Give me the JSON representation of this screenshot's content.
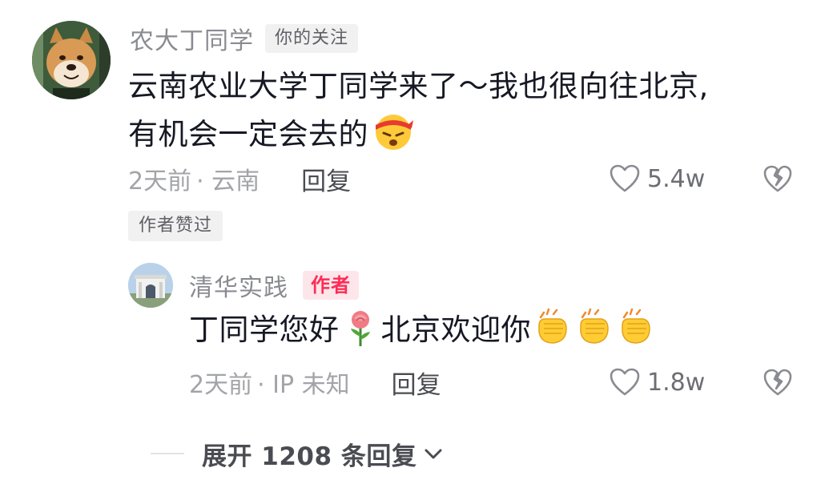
{
  "comment": {
    "username": "农大丁同学",
    "relation_tag": "你的关注",
    "text_line1": "云南农业大学丁同学来了～我也很向往北京,",
    "text_line2": "有机会一定会去的",
    "emoji": "angry-headband-emoji",
    "time": "2天前",
    "location": "· 云南",
    "reply_label": "回复",
    "likes": "5.4w",
    "author_liked": "作者赞过"
  },
  "reply": {
    "username": "清华实践",
    "author_tag": "作者",
    "text_before_emoji": "丁同学您好",
    "emoji_rose": "rose-emoji",
    "text_after_emoji": "北京欢迎你",
    "emoji_clap": "clapping-hands-emoji",
    "time": "2天前",
    "location": "· IP 未知",
    "reply_label": "回复",
    "likes": "1.8w"
  },
  "expand": {
    "label": "展开 1208 条回复"
  },
  "colors": {
    "username": "#8a8b91",
    "author_tag_text": "#fe2c55",
    "author_tag_bg": "#fde6ea",
    "tag_bg": "#f1f1f2"
  }
}
